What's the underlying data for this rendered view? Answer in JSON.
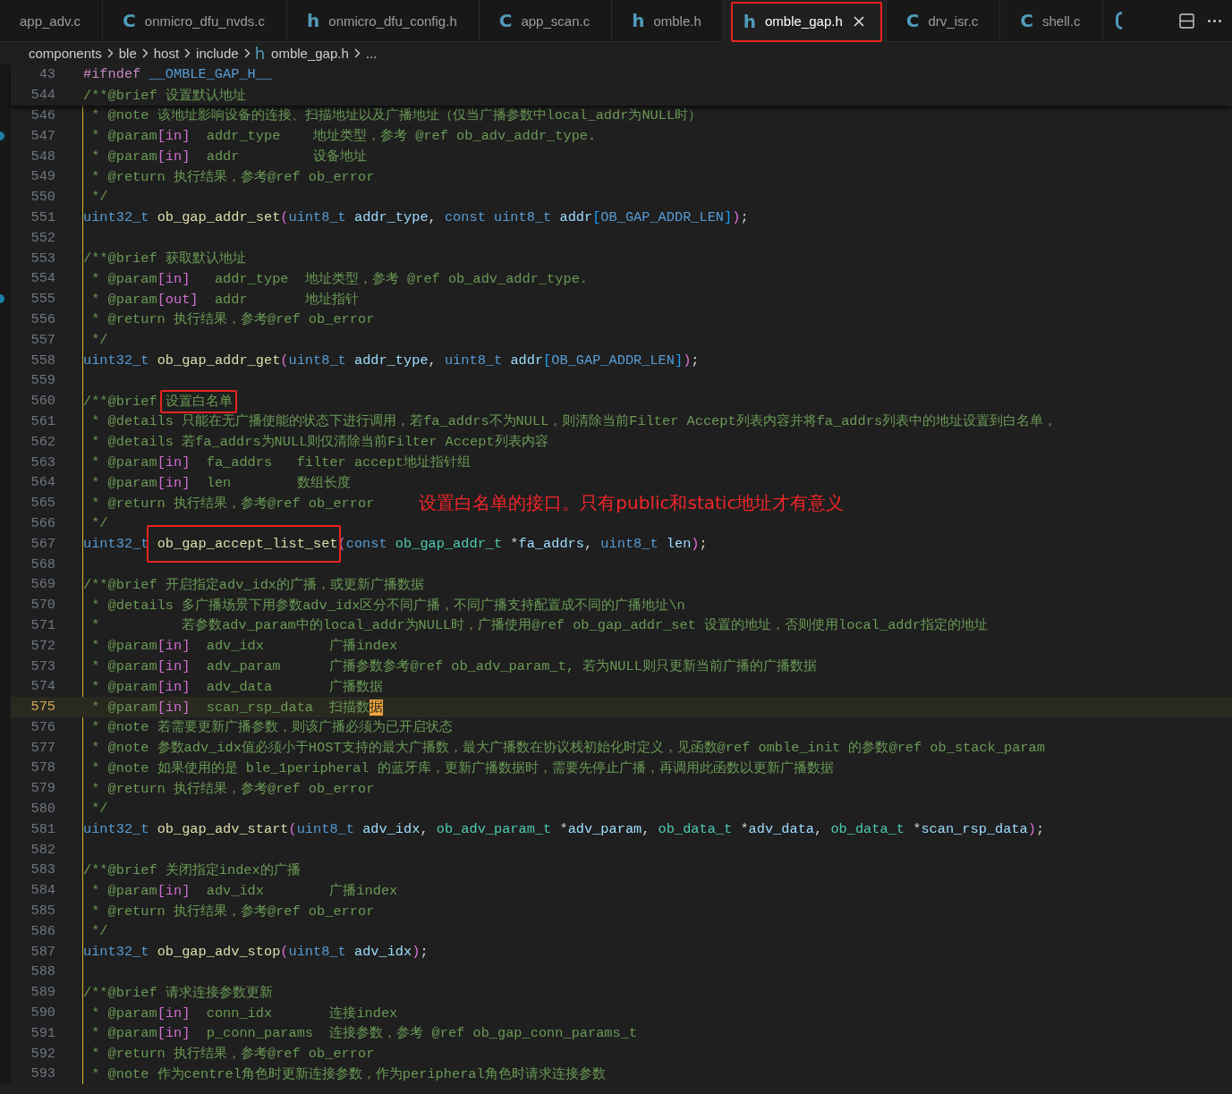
{
  "tabs": [
    {
      "label": "app_adv.c",
      "selected": false,
      "circled": false
    },
    {
      "type_letter": "C",
      "label": "onmicro_dfu_nvds.c",
      "selected": false,
      "circled": false
    },
    {
      "type_letter": "h",
      "label": "onmicro_dfu_config.h",
      "selected": false,
      "circled": false
    },
    {
      "type_letter": "C",
      "label": "app_scan.c",
      "selected": false,
      "circled": false
    },
    {
      "type_letter": "h",
      "label": "omble.h",
      "selected": false,
      "circled": false
    },
    {
      "type_letter": "h",
      "label": "omble_gap.h",
      "selected": true,
      "circled": true
    },
    {
      "type_letter": "C",
      "label": "drv_isr.c",
      "selected": false,
      "circled": false
    },
    {
      "type_letter": "C",
      "label": "shell.c",
      "selected": false,
      "circled": false
    }
  ],
  "breadcrumbs": [
    {
      "label": "components"
    },
    {
      "label": "ble"
    },
    {
      "label": "host"
    },
    {
      "label": "include"
    },
    {
      "type_letter": "h",
      "label": "omble_gap.h"
    },
    {
      "label": "..."
    }
  ],
  "sticky_lines": [
    {
      "number": "43",
      "tokens": [
        {
          "kind": "preproc",
          "text": "#ifndef "
        },
        {
          "kind": "macro",
          "text": "__OMBLE_GAP_H__"
        }
      ]
    },
    {
      "number": "544",
      "tokens": [
        {
          "kind": "comment",
          "text": "/**@brief 设置默认地址"
        }
      ]
    }
  ],
  "lines": [
    {
      "number": "546",
      "tokens": [
        {
          "kind": "comment",
          "text": " * @note 该地址影响设备的连接、扫描地址以及广播地址（仅当广播参数中local_addr为NULL时）"
        }
      ]
    },
    {
      "number": "547",
      "changed": true,
      "tokens": [
        {
          "kind": "comment",
          "text": " * @param"
        },
        {
          "kind": "direction",
          "text": "[in]"
        },
        {
          "kind": "comment",
          "text": "  addr_type    地址类型，参考 @ref ob_adv_addr_type."
        }
      ]
    },
    {
      "number": "548",
      "tokens": [
        {
          "kind": "comment",
          "text": " * @param"
        },
        {
          "kind": "direction",
          "text": "[in]"
        },
        {
          "kind": "comment",
          "text": "  addr         设备地址"
        }
      ]
    },
    {
      "number": "549",
      "tokens": [
        {
          "kind": "comment",
          "text": " * @return 执行结果，参考@ref ob_error"
        }
      ]
    },
    {
      "number": "550",
      "tokens": [
        {
          "kind": "comment",
          "text": " */"
        }
      ]
    },
    {
      "number": "551",
      "tokens": [
        {
          "kind": "type",
          "text": "uint32_t "
        },
        {
          "kind": "function",
          "text": "ob_gap_addr_set"
        },
        {
          "kind": "paren",
          "text": "("
        },
        {
          "kind": "type",
          "text": "uint8_t "
        },
        {
          "kind": "param",
          "text": "addr_type"
        },
        {
          "kind": "punct",
          "text": ", "
        },
        {
          "kind": "type",
          "text": "const uint8_t "
        },
        {
          "kind": "param",
          "text": "addr"
        },
        {
          "kind": "square",
          "text": "["
        },
        {
          "kind": "macro",
          "text": "OB_GAP_ADDR_LEN"
        },
        {
          "kind": "square",
          "text": "]"
        },
        {
          "kind": "paren",
          "text": ")"
        },
        {
          "kind": "punct",
          "text": ";"
        }
      ]
    },
    {
      "number": "552"
    },
    {
      "number": "553",
      "tokens": [
        {
          "kind": "comment",
          "text": "/**@brief 获取默认地址"
        }
      ]
    },
    {
      "number": "554",
      "tokens": [
        {
          "kind": "comment",
          "text": " * @param"
        },
        {
          "kind": "direction",
          "text": "[in]"
        },
        {
          "kind": "comment",
          "text": "   addr_type  地址类型，参考 @ref ob_adv_addr_type."
        }
      ]
    },
    {
      "number": "555",
      "changed": true,
      "tokens": [
        {
          "kind": "comment",
          "text": " * @param"
        },
        {
          "kind": "direction",
          "text": "[out]"
        },
        {
          "kind": "comment",
          "text": "  addr       地址指针"
        }
      ]
    },
    {
      "number": "556",
      "tokens": [
        {
          "kind": "comment",
          "text": " * @return 执行结果，参考@ref ob_error"
        }
      ]
    },
    {
      "number": "557",
      "tokens": [
        {
          "kind": "comment",
          "text": " */"
        }
      ]
    },
    {
      "number": "558",
      "tokens": [
        {
          "kind": "type",
          "text": "uint32_t "
        },
        {
          "kind": "function",
          "text": "ob_gap_addr_get"
        },
        {
          "kind": "paren",
          "text": "("
        },
        {
          "kind": "type",
          "text": "uint8_t "
        },
        {
          "kind": "param",
          "text": "addr_type"
        },
        {
          "kind": "punct",
          "text": ", "
        },
        {
          "kind": "type",
          "text": "uint8_t "
        },
        {
          "kind": "param",
          "text": "addr"
        },
        {
          "kind": "square",
          "text": "["
        },
        {
          "kind": "macro",
          "text": "OB_GAP_ADDR_LEN"
        },
        {
          "kind": "square",
          "text": "]"
        },
        {
          "kind": "paren",
          "text": ")"
        },
        {
          "kind": "punct",
          "text": ";"
        }
      ]
    },
    {
      "number": "559"
    },
    {
      "number": "560",
      "tokens": [
        {
          "kind": "comment",
          "text": "/**@brief "
        },
        {
          "kind": "comment",
          "text": "设置白名单",
          "circled": true
        }
      ]
    },
    {
      "number": "561",
      "tokens": [
        {
          "kind": "comment",
          "text": " * @details 只能在无广播使能的状态下进行调用，若fa_addrs不为NULL，则清除当前Filter Accept列表内容并将fa_addrs列表中的地址设置到白名单，"
        }
      ]
    },
    {
      "number": "562",
      "tokens": [
        {
          "kind": "comment",
          "text": " * @details 若fa_addrs为NULL则仅清除当前Filter Accept列表内容"
        }
      ]
    },
    {
      "number": "563",
      "tokens": [
        {
          "kind": "comment",
          "text": " * @param"
        },
        {
          "kind": "direction",
          "text": "[in]"
        },
        {
          "kind": "comment",
          "text": "  fa_addrs   filter accept地址指针组"
        }
      ]
    },
    {
      "number": "564",
      "tokens": [
        {
          "kind": "comment",
          "text": " * @param"
        },
        {
          "kind": "direction",
          "text": "[in]"
        },
        {
          "kind": "comment",
          "text": "  len        数组长度"
        }
      ]
    },
    {
      "number": "565",
      "tokens": [
        {
          "kind": "comment",
          "text": " * @return 执行结果，参考@ref ob_error"
        }
      ],
      "note": "设置白名单的接口。只有public和static地址才有意义"
    },
    {
      "number": "566",
      "tokens": [
        {
          "kind": "comment",
          "text": " */"
        }
      ]
    },
    {
      "number": "567",
      "tokens": [
        {
          "kind": "type",
          "text": "uint32_t "
        },
        {
          "kind": "function",
          "text": "ob_gap_accept_list_set",
          "circled": true
        },
        {
          "kind": "paren",
          "text": "("
        },
        {
          "kind": "type",
          "text": "const "
        },
        {
          "kind": "typedef",
          "text": "ob_gap_addr_t"
        },
        {
          "kind": "punct",
          "text": " *"
        },
        {
          "kind": "param",
          "text": "fa_addrs"
        },
        {
          "kind": "punct",
          "text": ", "
        },
        {
          "kind": "type",
          "text": "uint8_t "
        },
        {
          "kind": "param",
          "text": "len"
        },
        {
          "kind": "paren",
          "text": ")"
        },
        {
          "kind": "punct",
          "text": ";"
        }
      ]
    },
    {
      "number": "568"
    },
    {
      "number": "569",
      "tokens": [
        {
          "kind": "comment",
          "text": "/**@brief 开启指定adv_idx的广播，或更新广播数据"
        }
      ]
    },
    {
      "number": "570",
      "tokens": [
        {
          "kind": "comment",
          "text": " * @details 多广播场景下用参数adv_idx区分不同广播，不同广播支持配置成不同的广播地址\\n"
        }
      ]
    },
    {
      "number": "571",
      "tokens": [
        {
          "kind": "comment",
          "text": " *          若参数adv_param中的local_addr为NULL时，广播使用@ref ob_gap_addr_set 设置的地址，否则使用local_addr指定的地址"
        }
      ]
    },
    {
      "number": "572",
      "tokens": [
        {
          "kind": "comment",
          "text": " * @param"
        },
        {
          "kind": "direction",
          "text": "[in]"
        },
        {
          "kind": "comment",
          "text": "  adv_idx        广播index"
        }
      ]
    },
    {
      "number": "573",
      "tokens": [
        {
          "kind": "comment",
          "text": " * @param"
        },
        {
          "kind": "direction",
          "text": "[in]"
        },
        {
          "kind": "comment",
          "text": "  adv_param      广播参数参考@ref ob_adv_param_t, 若为NULL则只更新当前广播的广播数据"
        }
      ]
    },
    {
      "number": "574",
      "tokens": [
        {
          "kind": "comment",
          "text": " * @param"
        },
        {
          "kind": "direction",
          "text": "[in]"
        },
        {
          "kind": "comment",
          "text": "  adv_data       广播数据"
        }
      ]
    },
    {
      "number": "575",
      "current": true,
      "tokens": [
        {
          "kind": "comment",
          "text": " * @param"
        },
        {
          "kind": "direction",
          "text": "[in]"
        },
        {
          "kind": "comment",
          "text": "  scan_rsp_data  扫描数"
        },
        {
          "kind": "match",
          "text": "据"
        }
      ]
    },
    {
      "number": "576",
      "tokens": [
        {
          "kind": "comment",
          "text": " * @note 若需要更新广播参数，则该广播必须为已开启状态"
        }
      ]
    },
    {
      "number": "577",
      "tokens": [
        {
          "kind": "comment",
          "text": " * @note 参数adv_idx值必须小于HOST支持的最大广播数，最大广播数在协议栈初始化时定义，见函数@ref omble_init 的参数@ref ob_stack_param"
        }
      ]
    },
    {
      "number": "578",
      "tokens": [
        {
          "kind": "comment",
          "text": " * @note 如果使用的是 ble_1peripheral 的蓝牙库，更新广播数据时，需要先停止广播，再调用此函数以更新广播数据"
        }
      ]
    },
    {
      "number": "579",
      "tokens": [
        {
          "kind": "comment",
          "text": " * @return 执行结果，参考@ref ob_error"
        }
      ]
    },
    {
      "number": "580",
      "tokens": [
        {
          "kind": "comment",
          "text": " */"
        }
      ]
    },
    {
      "number": "581",
      "tokens": [
        {
          "kind": "type",
          "text": "uint32_t "
        },
        {
          "kind": "function",
          "text": "ob_gap_adv_start"
        },
        {
          "kind": "paren",
          "text": "("
        },
        {
          "kind": "type",
          "text": "uint8_t "
        },
        {
          "kind": "param",
          "text": "adv_idx"
        },
        {
          "kind": "punct",
          "text": ", "
        },
        {
          "kind": "typedef",
          "text": "ob_adv_param_t"
        },
        {
          "kind": "punct",
          "text": " *"
        },
        {
          "kind": "param",
          "text": "adv_param"
        },
        {
          "kind": "punct",
          "text": ", "
        },
        {
          "kind": "typedef",
          "text": "ob_data_t"
        },
        {
          "kind": "punct",
          "text": " *"
        },
        {
          "kind": "param",
          "text": "adv_data"
        },
        {
          "kind": "punct",
          "text": ", "
        },
        {
          "kind": "typedef",
          "text": "ob_data_t"
        },
        {
          "kind": "punct",
          "text": " *"
        },
        {
          "kind": "param",
          "text": "scan_rsp_data"
        },
        {
          "kind": "paren",
          "text": ")"
        },
        {
          "kind": "punct",
          "text": ";"
        }
      ]
    },
    {
      "number": "582"
    },
    {
      "number": "583",
      "tokens": [
        {
          "kind": "comment",
          "text": "/**@brief 关闭指定index的广播"
        }
      ]
    },
    {
      "number": "584",
      "tokens": [
        {
          "kind": "comment",
          "text": " * @param"
        },
        {
          "kind": "direction",
          "text": "[in]"
        },
        {
          "kind": "comment",
          "text": "  adv_idx        广播index"
        }
      ]
    },
    {
      "number": "585",
      "tokens": [
        {
          "kind": "comment",
          "text": " * @return 执行结果，参考@ref ob_error"
        }
      ]
    },
    {
      "number": "586",
      "tokens": [
        {
          "kind": "comment",
          "text": " */"
        }
      ]
    },
    {
      "number": "587",
      "tokens": [
        {
          "kind": "type",
          "text": "uint32_t "
        },
        {
          "kind": "function",
          "text": "ob_gap_adv_stop"
        },
        {
          "kind": "paren",
          "text": "("
        },
        {
          "kind": "type",
          "text": "uint8_t "
        },
        {
          "kind": "param",
          "text": "adv_idx"
        },
        {
          "kind": "paren",
          "text": ")"
        },
        {
          "kind": "punct",
          "text": ";"
        }
      ]
    },
    {
      "number": "588"
    },
    {
      "number": "589",
      "tokens": [
        {
          "kind": "comment",
          "text": "/**@brief 请求连接参数更新"
        }
      ]
    },
    {
      "number": "590",
      "tokens": [
        {
          "kind": "comment",
          "text": " * @param"
        },
        {
          "kind": "direction",
          "text": "[in]"
        },
        {
          "kind": "comment",
          "text": "  conn_idx       连接index"
        }
      ]
    },
    {
      "number": "591",
      "tokens": [
        {
          "kind": "comment",
          "text": " * @param"
        },
        {
          "kind": "direction",
          "text": "[in]"
        },
        {
          "kind": "comment",
          "text": "  p_conn_params  连接参数，参考 @ref ob_gap_conn_params_t"
        }
      ]
    },
    {
      "number": "592",
      "tokens": [
        {
          "kind": "comment",
          "text": " * @return 执行结果，参考@ref ob_error"
        }
      ]
    },
    {
      "number": "593",
      "tokens": [
        {
          "kind": "comment",
          "text": " * @note 作为centrel角色时更新连接参数，作为peripheral角色时请求连接参数"
        }
      ]
    }
  ]
}
